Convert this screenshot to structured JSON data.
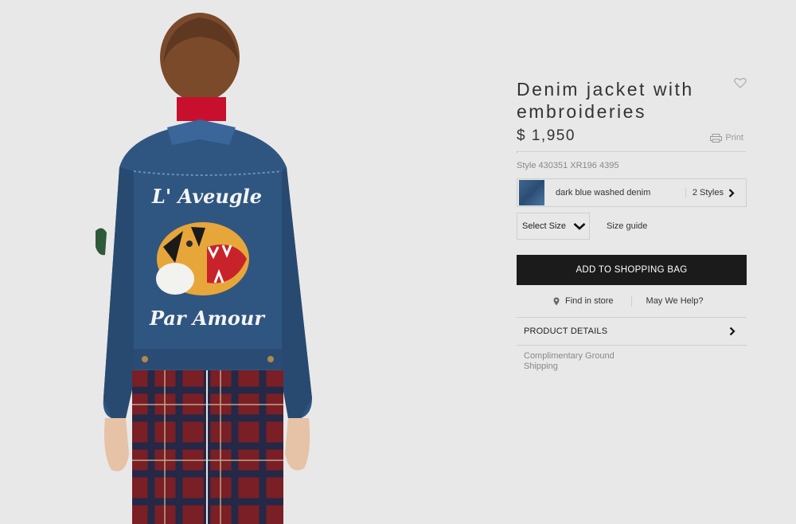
{
  "product": {
    "title": "Denim jacket with embroideries",
    "price": "$ 1,950",
    "style_code": "Style 430351 XR196 4395"
  },
  "actions": {
    "print_label": "Print",
    "wishlist_icon": "heart-icon"
  },
  "variant": {
    "color_name": "dark blue washed denim",
    "styles_label": "2 Styles",
    "swatch_color": "#2f5680"
  },
  "size": {
    "select_label": "Select Size",
    "guide_label": "Size guide"
  },
  "cart": {
    "add_label": "ADD TO SHOPPING BAG"
  },
  "help": {
    "find_label": "Find in store",
    "help_label": "May We Help?"
  },
  "details": {
    "label": "PRODUCT DETAILS",
    "shipping": "Complimentary Ground Shipping"
  },
  "image": {
    "embroidery_top": "L' Aveugle",
    "embroidery_bottom": "Par Amour"
  },
  "colors": {
    "background": "#e8e8e9",
    "button": "#1b1b1b",
    "denim": "#2f5680"
  }
}
